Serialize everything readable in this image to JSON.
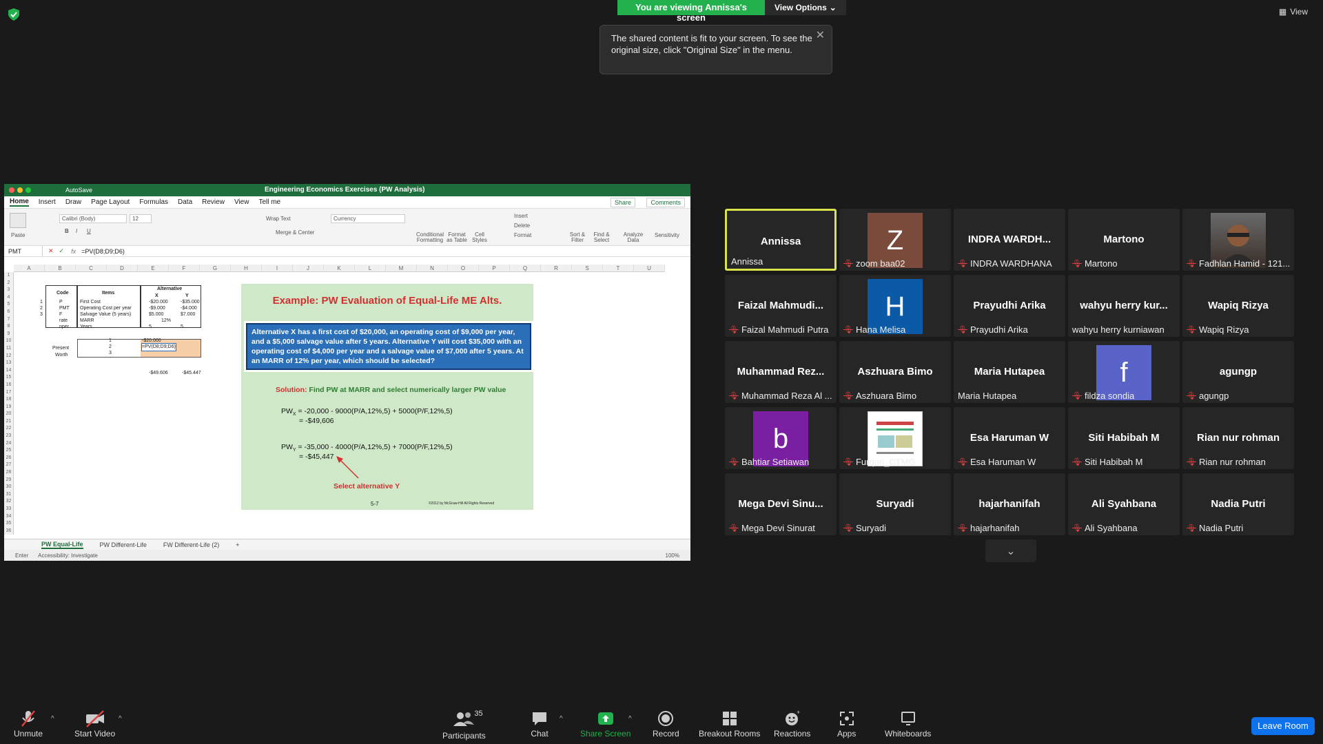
{
  "banner": {
    "viewing": "You are viewing Annissa's screen",
    "view_options": "View Options"
  },
  "view_label": "View",
  "tooltip": {
    "text": "The shared content is fit to your screen. To see the original size, click \"Original Size\" in the menu."
  },
  "excel": {
    "autosave": "AutoSave",
    "title": "Engineering Economics Exercises (PW Analysis)",
    "tabs": [
      "Home",
      "Insert",
      "Draw",
      "Page Layout",
      "Formulas",
      "Data",
      "Review",
      "View",
      "Tell me"
    ],
    "share": "Share",
    "comments": "Comments",
    "font": "Calibri (Body)",
    "font_size": "12",
    "number_format": "Currency",
    "ribbon": {
      "paste": "Paste",
      "wrap": "Wrap Text",
      "merge": "Merge & Center",
      "cond": "Conditional Formatting",
      "fmt_table": "Format as Table",
      "cell_styles": "Cell Styles",
      "insert": "Insert",
      "delete": "Delete",
      "format": "Format",
      "sort": "Sort & Filter",
      "find": "Find & Select",
      "analyze": "Analyze Data",
      "sensitivity": "Sensitivity"
    },
    "namebox": "PMT",
    "formula": "=PV(D8;D9;D6)",
    "columns": [
      "A",
      "B",
      "C",
      "D",
      "E",
      "F",
      "G",
      "H",
      "I",
      "J",
      "K",
      "L",
      "M",
      "N",
      "O",
      "P",
      "Q",
      "R",
      "S",
      "T",
      "U"
    ],
    "table": {
      "code": "Code",
      "items": "Items",
      "alternative": "Alternative",
      "x": "X",
      "y": "Y",
      "rows": [
        {
          "n": "1",
          "code": "P",
          "item": "First Cost",
          "x": "-$20.000",
          "y": "-$35.000"
        },
        {
          "n": "2",
          "code": "PMT",
          "item": "Operating Cost per year",
          "x": "-$9.000",
          "y": "-$4.000"
        },
        {
          "n": "3",
          "code": "F",
          "item": "Salvage Value (5 years)",
          "x": "$5.000",
          "y": "$7.000"
        },
        {
          "n": "",
          "code": "rate",
          "item": "MARR",
          "x": "12%",
          "y": ""
        },
        {
          "n": "",
          "code": "nper",
          "item": "Years",
          "x": "5",
          "y": "5"
        }
      ],
      "present": "Present",
      "worth": "Worth",
      "pw_rows": [
        {
          "n": "1",
          "x": "-$20.000"
        },
        {
          "n": "2",
          "x": "=PV(D8;D9;D6)"
        },
        {
          "n": "3",
          "x": ""
        }
      ],
      "totals": {
        "x": "-$49.606",
        "y": "-$45.447"
      }
    },
    "slide": {
      "title": "Example: PW Evaluation of Equal-Life ME Alts.",
      "problem": "Alternative X has a first cost of $20,000, an operating cost of $9,000 per year, and a $5,000 salvage value after 5 years. Alternative Y will cost $35,000 with an operating cost of $4,000 per year and a salvage value of  $7,000 after 5 years. At an MARR of 12% per year, which should be selected?",
      "solution_label": "Solution:",
      "solution": "Find PW at MARR and select numerically larger PW value",
      "eq_x1": "PW",
      "eq_x_sub": "X",
      "eq_x_rest": " = -20,000 - 9000(P/A,12%,5) + 5000(P/F,12%,5)",
      "eq_x2": "= -$49,606",
      "eq_y_sub": "Y",
      "eq_y_rest": " = -35,000 - 4000(P/A,12%,5) + 7000(P/F,12%,5)",
      "eq_y2": "= -$45,447",
      "select": "Select alternative Y",
      "page": "5-7",
      "copyright": "©2012 by McGraw-Hill    All Rights Reserved"
    },
    "sheets": [
      "PW Equal-Life",
      "PW Different-Life",
      "FW Different-Life (2)"
    ],
    "status": {
      "mode": "Enter",
      "accessibility": "Accessibility: Investigate",
      "zoom": "100%"
    }
  },
  "participants": [
    {
      "big": "Annissa",
      "name": "Annissa",
      "muted": false,
      "active": true
    },
    {
      "avatar": "Z",
      "avatar_color": "#7a4a3a",
      "name": "zoom baa02",
      "muted": true
    },
    {
      "big": "INDRA  WARDH...",
      "name": "INDRA WARDHANA",
      "muted": true
    },
    {
      "big": "Martono",
      "name": "Martono",
      "muted": true
    },
    {
      "photo": true,
      "name": "Fadhlan Hamid - 121...",
      "muted": true
    },
    {
      "big": "Faizal  Mahmudi...",
      "name": "Faizal Mahmudi Putra",
      "muted": true
    },
    {
      "avatar": "H",
      "avatar_color": "#0a5aa8",
      "name": "Hana Melisa",
      "muted": true
    },
    {
      "big": "Prayudhi Arika",
      "name": "Prayudhi Arika",
      "muted": true
    },
    {
      "big": "wahyu  herry  kur...",
      "name": "wahyu herry kurniawan",
      "muted": false
    },
    {
      "big": "Wapiq Rizya",
      "name": "Wapiq Rizya",
      "muted": true
    },
    {
      "big": "Muhammad  Rez...",
      "name": "Muhammad Reza Al ...",
      "muted": true
    },
    {
      "big": "Aszhuara Bimo",
      "name": "Aszhuara Bimo",
      "muted": true
    },
    {
      "big": "Maria Hutapea",
      "name": "Maria Hutapea",
      "muted": false
    },
    {
      "avatar": "f",
      "avatar_color": "#5a64c8",
      "name": "fildza sondia",
      "muted": true
    },
    {
      "big": "agungp",
      "name": "agungp",
      "muted": true
    },
    {
      "avatar": "b",
      "avatar_color": "#7a1fa2",
      "name": "Bahtiar Setiawan",
      "muted": true
    },
    {
      "poster": true,
      "name": "Furqon_CTMG",
      "muted": true
    },
    {
      "big": "Esa Haruman W",
      "name": "Esa Haruman W",
      "muted": true
    },
    {
      "big": "Siti Habibah M",
      "name": "Siti Habibah M",
      "muted": true
    },
    {
      "big": "Rian nur rohman",
      "name": "Rian nur rohman",
      "muted": true
    },
    {
      "big": "Mega  Devi  Sinu...",
      "name": "Mega Devi Sinurat",
      "muted": true
    },
    {
      "big": "Suryadi",
      "name": "Suryadi",
      "muted": true
    },
    {
      "big": "hajarhanifah",
      "name": "hajarhanifah",
      "muted": true
    },
    {
      "big": "Ali Syahbana",
      "name": "Ali Syahbana",
      "muted": true
    },
    {
      "big": "Nadia Putri",
      "name": "Nadia Putri",
      "muted": true
    }
  ],
  "toolbar": {
    "unmute": "Unmute",
    "start_video": "Start Video",
    "participants": "Participants",
    "participants_count": "35",
    "chat": "Chat",
    "share_screen": "Share Screen",
    "record": "Record",
    "breakout": "Breakout Rooms",
    "reactions": "Reactions",
    "apps": "Apps",
    "whiteboards": "Whiteboards",
    "leave": "Leave Room"
  },
  "colors": {
    "share_green": "#23b14d",
    "leave_blue": "#0e72ed",
    "active_tile": "#d9e34c",
    "excel_green": "#1e6e3c"
  }
}
